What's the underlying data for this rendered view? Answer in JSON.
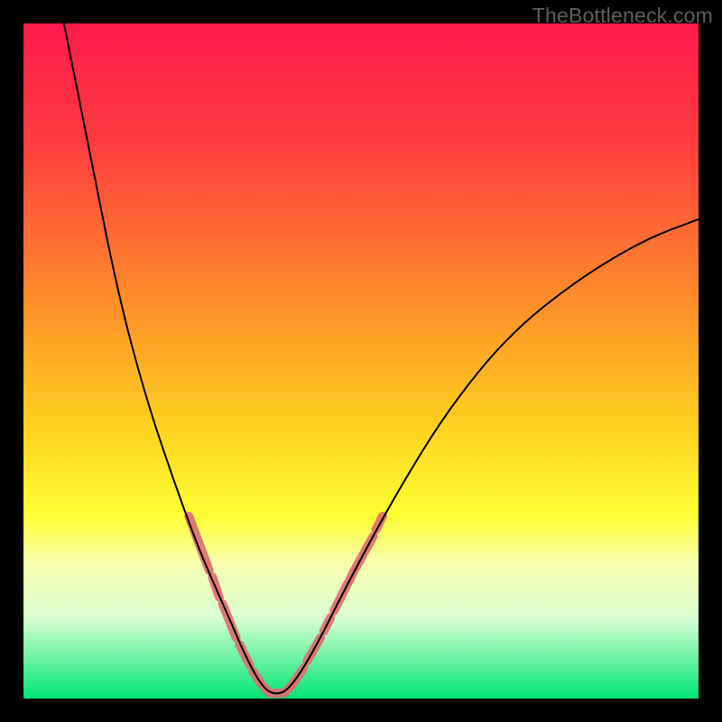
{
  "watermark": "TheBottleneck.com",
  "chart_data": {
    "type": "line",
    "title": "",
    "xlabel": "",
    "ylabel": "",
    "xlim": [
      0,
      100
    ],
    "ylim": [
      0,
      100
    ],
    "gradient_stops": [
      {
        "offset": 0,
        "color": "#ff1a4b"
      },
      {
        "offset": 18,
        "color": "#ff3d3f"
      },
      {
        "offset": 40,
        "color": "#ff8a2a"
      },
      {
        "offset": 60,
        "color": "#ffd21f"
      },
      {
        "offset": 73,
        "color": "#ffff33"
      },
      {
        "offset": 80,
        "color": "#f8ffb0"
      },
      {
        "offset": 88,
        "color": "#d9ffd0"
      },
      {
        "offset": 100,
        "color": "#00e676"
      }
    ],
    "series": [
      {
        "name": "bottleneck-curve",
        "points": [
          {
            "x": 6,
            "y": 100
          },
          {
            "x": 10,
            "y": 80
          },
          {
            "x": 14,
            "y": 60
          },
          {
            "x": 18,
            "y": 45
          },
          {
            "x": 22,
            "y": 33
          },
          {
            "x": 26,
            "y": 22
          },
          {
            "x": 30,
            "y": 13
          },
          {
            "x": 33,
            "y": 6
          },
          {
            "x": 35.5,
            "y": 1.5
          },
          {
            "x": 37.5,
            "y": 0.5
          },
          {
            "x": 39.5,
            "y": 1.5
          },
          {
            "x": 43,
            "y": 7
          },
          {
            "x": 48,
            "y": 17
          },
          {
            "x": 55,
            "y": 30
          },
          {
            "x": 63,
            "y": 43
          },
          {
            "x": 72,
            "y": 54
          },
          {
            "x": 82,
            "y": 62
          },
          {
            "x": 92,
            "y": 68
          },
          {
            "x": 100,
            "y": 71
          }
        ]
      }
    ],
    "highlight_segments": [
      {
        "x1": 24.5,
        "y1": 27,
        "x2": 27.5,
        "y2": 19,
        "len": 36
      },
      {
        "x1": 28,
        "y1": 18,
        "x2": 29,
        "y2": 15,
        "len": 14
      },
      {
        "x1": 29.5,
        "y1": 14,
        "x2": 31.5,
        "y2": 9,
        "len": 24
      },
      {
        "x1": 32,
        "y1": 8,
        "x2": 33.5,
        "y2": 5,
        "len": 16
      },
      {
        "x1": 34,
        "y1": 4,
        "x2": 35,
        "y2": 2.5,
        "len": 12
      },
      {
        "x1": 35.3,
        "y1": 2,
        "x2": 36.3,
        "y2": 1,
        "len": 12
      },
      {
        "x1": 36.5,
        "y1": 0.8,
        "x2": 38.5,
        "y2": 0.8,
        "len": 16
      },
      {
        "x1": 38.8,
        "y1": 1,
        "x2": 39.8,
        "y2": 2,
        "len": 12
      },
      {
        "x1": 40,
        "y1": 2.3,
        "x2": 41.5,
        "y2": 4.5,
        "len": 14
      },
      {
        "x1": 42,
        "y1": 5.5,
        "x2": 44,
        "y2": 9,
        "len": 18
      },
      {
        "x1": 44.5,
        "y1": 10,
        "x2": 45.5,
        "y2": 12,
        "len": 12
      },
      {
        "x1": 46,
        "y1": 13,
        "x2": 48,
        "y2": 17,
        "len": 20
      },
      {
        "x1": 48.3,
        "y1": 17.5,
        "x2": 49,
        "y2": 19,
        "len": 8
      },
      {
        "x1": 49.3,
        "y1": 19.5,
        "x2": 51.8,
        "y2": 24,
        "len": 24
      },
      {
        "x1": 52.2,
        "y1": 25,
        "x2": 53.2,
        "y2": 27,
        "len": 10
      }
    ],
    "highlight_color": "#e06e72",
    "highlight_width": 10,
    "curve_color": "#000000",
    "curve_width": 2
  }
}
